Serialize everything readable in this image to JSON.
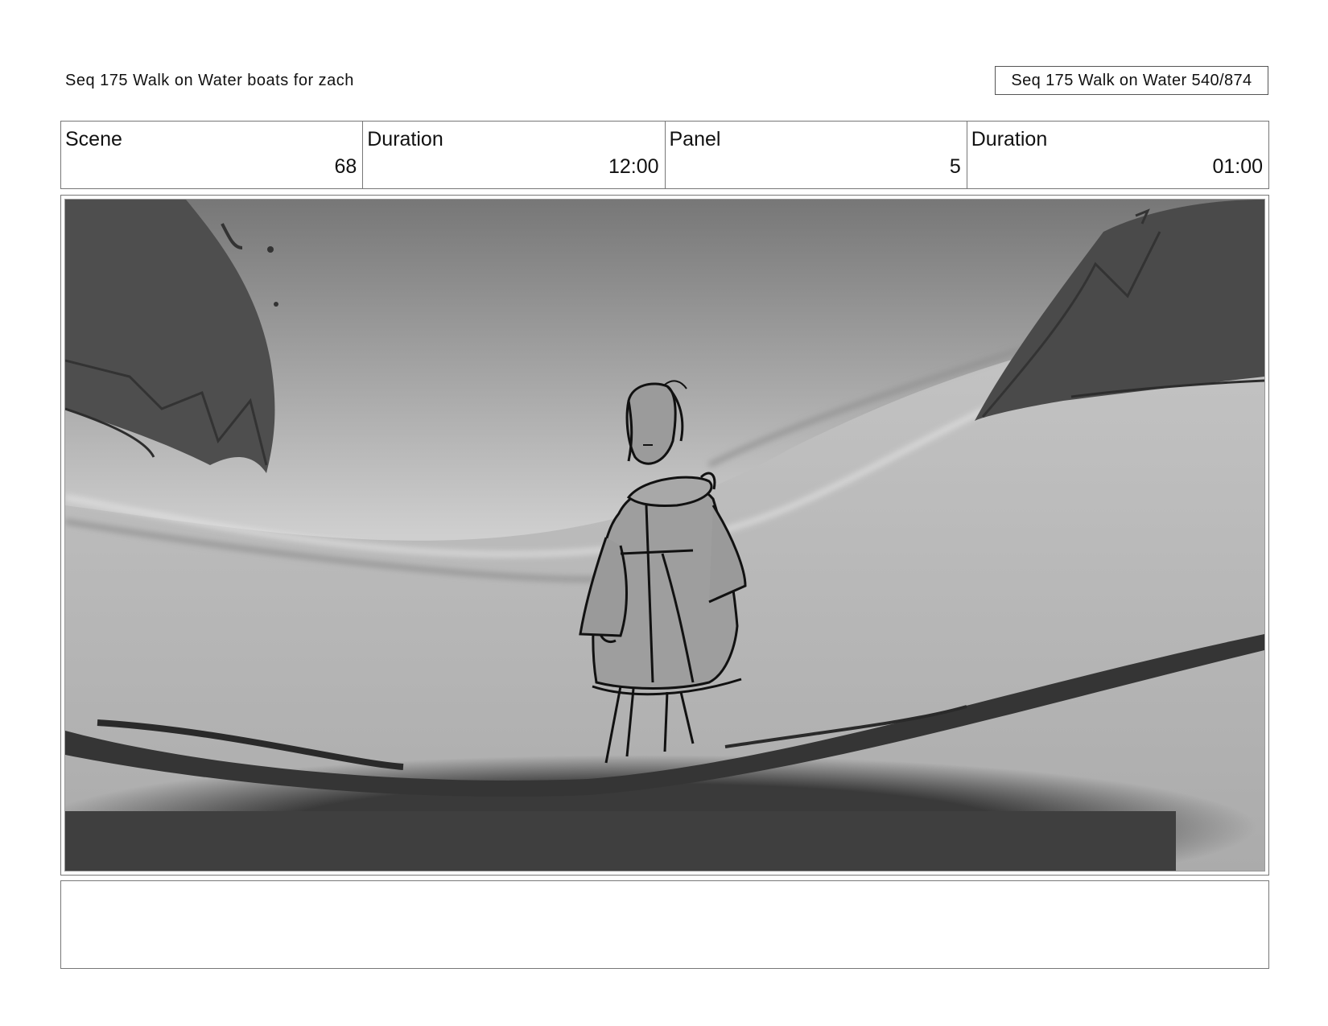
{
  "header": {
    "left_title": "Seq 175 Walk on Water  boats for zach",
    "right_title": "Seq 175 Walk on Water 540/874"
  },
  "info": [
    {
      "label": "Scene",
      "value": "68"
    },
    {
      "label": "Duration",
      "value": "12:00"
    },
    {
      "label": "Panel",
      "value": "5"
    },
    {
      "label": "Duration",
      "value": "01:00"
    }
  ],
  "panel": {
    "image_subject": "storyboard-sketch-robed-figure-walking-on-water",
    "notes": ""
  }
}
